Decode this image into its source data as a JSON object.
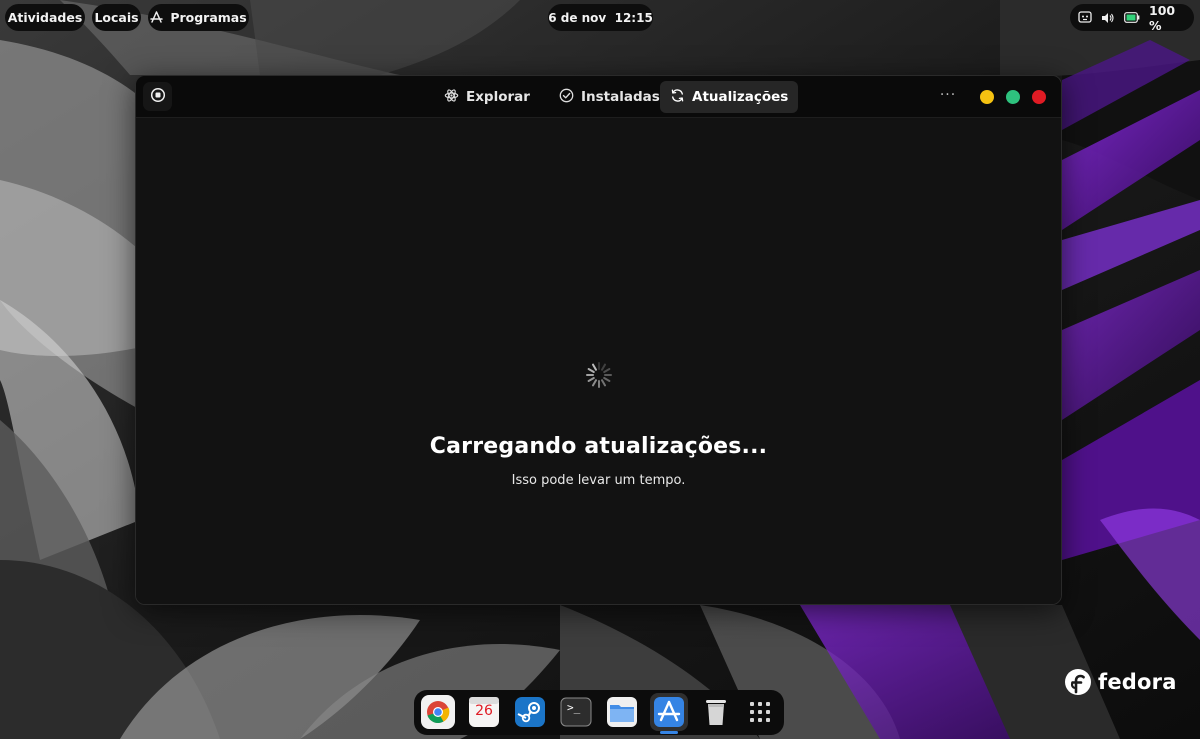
{
  "topbar": {
    "activities": "Atividades",
    "places": "Locais",
    "programs": "Programas",
    "clock": "6 de nov  12:15",
    "battery": "100 %"
  },
  "window": {
    "tabs": [
      {
        "label": "Explorar",
        "icon": "explore-icon",
        "active": false
      },
      {
        "label": "Instaladas",
        "icon": "check-icon",
        "active": false
      },
      {
        "label": "Atualizações",
        "icon": "refresh-icon",
        "active": true
      }
    ],
    "menu_label": "···",
    "loading": {
      "title": "Carregando atualizações...",
      "subtitle": "Isso pode levar um tempo."
    },
    "controls": {
      "minimize_color": "#f5c211",
      "maximize_color": "#2ec27e",
      "close_color": "#e01b24"
    }
  },
  "dock": {
    "items": [
      {
        "name": "chrome-icon"
      },
      {
        "name": "calendar-icon",
        "label": "26"
      },
      {
        "name": "steam-icon"
      },
      {
        "name": "terminal-icon",
        "label": ">_"
      },
      {
        "name": "files-icon"
      },
      {
        "name": "software-icon",
        "active": true
      },
      {
        "name": "trash-icon"
      },
      {
        "name": "app-grid-icon"
      }
    ]
  },
  "brand": {
    "wordmark": "fedora"
  },
  "colors": {
    "accent": "#3584e4",
    "wallpaper_purple": "#6b1fb0"
  }
}
